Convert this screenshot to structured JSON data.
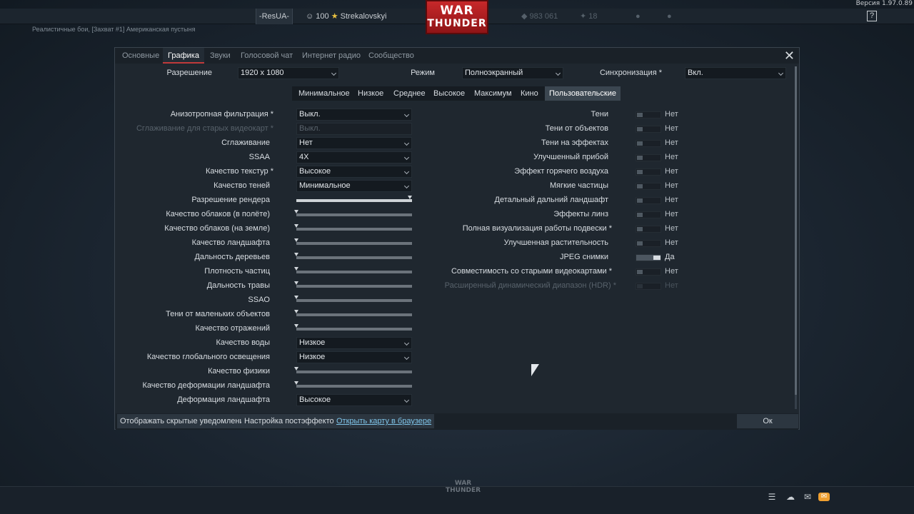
{
  "top": {
    "version": "Версия 1.97.0.89",
    "clan": "-ResUA-",
    "player": {
      "level": "100",
      "name": "Strekalovskyi"
    },
    "lions": "983 061",
    "eagles": "18",
    "logo": {
      "line1": "WAR",
      "line2": "THUNDER"
    },
    "help": "?",
    "mission": "Реалистичные бои, [Захват #1] Американская пустыня"
  },
  "tabs": [
    "Основные",
    "Графика",
    "Звуки",
    "Голосовой чат",
    "Интернет радио",
    "Сообщество"
  ],
  "header": {
    "resolution_label": "Разрешение",
    "resolution_value": "1920 x 1080",
    "mode_label": "Режим",
    "mode_value": "Полноэкранный",
    "sync_label": "Синхронизация *",
    "sync_value": "Вкл."
  },
  "presets": [
    "Минимальное",
    "Низкое",
    "Среднее",
    "Высокое",
    "Максимум",
    "Кино",
    "Пользовательские"
  ],
  "left": [
    {
      "label": "Анизотропная фильтрация *",
      "value": "Выкл."
    },
    {
      "label": "Сглаживание для старых видеокарт *",
      "value": "Выкл."
    },
    {
      "label": "Сглаживание",
      "value": "Нет"
    },
    {
      "label": "SSAA",
      "value": "4X"
    },
    {
      "label": "Качество текстур *",
      "value": "Высокое"
    },
    {
      "label": "Качество теней",
      "value": "Минимальное"
    },
    {
      "label": "Разрешение рендера",
      "level": 1.0
    },
    {
      "label": "Качество облаков (в полёте)",
      "level": 0
    },
    {
      "label": "Качество облаков (на земле)",
      "level": 0
    },
    {
      "label": "Качество ландшафта",
      "level": 0
    },
    {
      "label": "Дальность деревьев",
      "level": 0
    },
    {
      "label": "Плотность частиц",
      "level": 0
    },
    {
      "label": "Дальность травы",
      "level": 0
    },
    {
      "label": "SSAO",
      "level": 0
    },
    {
      "label": "Тени от маленьких объектов",
      "level": 0
    },
    {
      "label": "Качество отражений",
      "level": 0
    },
    {
      "label": "Качество воды",
      "value": "Низкое"
    },
    {
      "label": "Качество глобального освещения",
      "value": "Низкое"
    },
    {
      "label": "Качество физики",
      "level": 0
    },
    {
      "label": "Качество деформации ландшафта",
      "level": 0
    },
    {
      "label": "Деформация ландшафта",
      "value": "Высокое"
    }
  ],
  "right": [
    {
      "label": "Тени",
      "value": "Нет"
    },
    {
      "label": "Тени от объектов",
      "value": "Нет"
    },
    {
      "label": "Тени на эффектах",
      "value": "Нет"
    },
    {
      "label": "Улучшенный прибой",
      "value": "Нет"
    },
    {
      "label": "Эффект горячего воздуха",
      "value": "Нет"
    },
    {
      "label": "Мягкие частицы",
      "value": "Нет"
    },
    {
      "label": "Детальный дальний ландшафт",
      "value": "Нет"
    },
    {
      "label": "Эффекты линз",
      "value": "Нет"
    },
    {
      "label": "Полная визуализация работы подвески *",
      "value": "Нет"
    },
    {
      "label": "Улучшенная растительность",
      "value": "Нет"
    },
    {
      "label": "JPEG снимки",
      "value": "Да"
    },
    {
      "label": "Совместимость со старыми видеокартами *",
      "value": "Нет"
    },
    {
      "label": "Расширенный динамический диапазон (HDR) *",
      "value": "Нет"
    }
  ],
  "bottom": {
    "hidden_notifications": "Отображать скрытые уведомления",
    "posteffects": "Настройка постэффектов",
    "open_map": "Открыть карту в браузере",
    "ok": "Ок"
  },
  "footer": {
    "logo_line1": "WAR",
    "logo_line2": "THUNDER"
  }
}
